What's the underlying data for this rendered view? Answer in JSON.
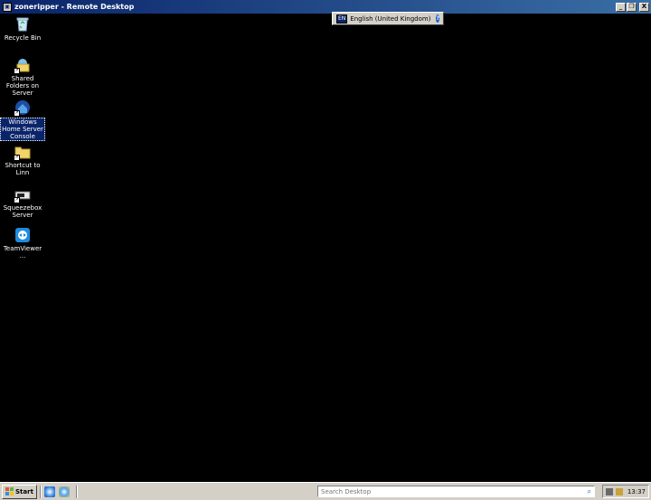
{
  "window": {
    "title": "zoneripper - Remote Desktop",
    "buttons": {
      "minimize": "_",
      "restore": "❐",
      "close": "X"
    }
  },
  "language_bar": {
    "code": "EN",
    "language": "English (United Kingdom)",
    "help": "?",
    "options": "▾"
  },
  "desktop_icons": [
    {
      "label": "Recycle Bin"
    },
    {
      "label": "Shared Folders on Server"
    },
    {
      "label": "Windows Home Server Console"
    },
    {
      "label": "Shortcut to Linn"
    },
    {
      "label": "Squeezebox Server"
    },
    {
      "label": "TeamViewer ..."
    }
  ],
  "taskbar": {
    "start_label": "Start",
    "search_placeholder": "Search Desktop",
    "clock": "13:37"
  },
  "colors": {
    "desktop_background": "#000000",
    "title_bar": "#0a246a",
    "selection": "#0a246a",
    "chrome": "#d4d0c8"
  }
}
